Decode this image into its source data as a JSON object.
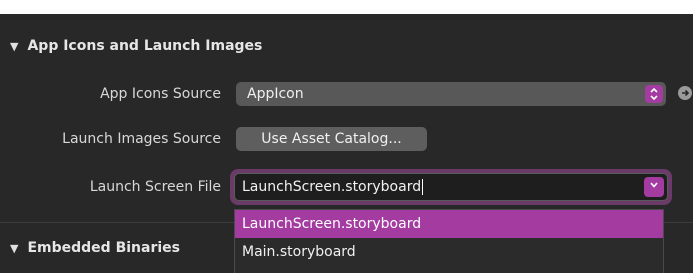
{
  "sections": {
    "app_icons": {
      "title": "App Icons and Launch Images",
      "triangle": "▼"
    },
    "embedded": {
      "title": "Embedded Binaries",
      "triangle": "▼"
    }
  },
  "rows": {
    "app_icons_source": {
      "label": "App Icons Source",
      "value": "AppIcon",
      "stepper_icon": "⌃⌄"
    },
    "launch_images_source": {
      "label": "Launch Images Source",
      "button": "Use Asset Catalog..."
    },
    "launch_screen_file": {
      "label": "Launch Screen File",
      "value": "LaunchScreen.storyboard"
    }
  },
  "dropdown": {
    "options": [
      "LaunchScreen.storyboard",
      "Main.storyboard"
    ],
    "selected_index": 0
  },
  "colors": {
    "accent": "#a33ba0",
    "panel_bg": "#282828"
  }
}
